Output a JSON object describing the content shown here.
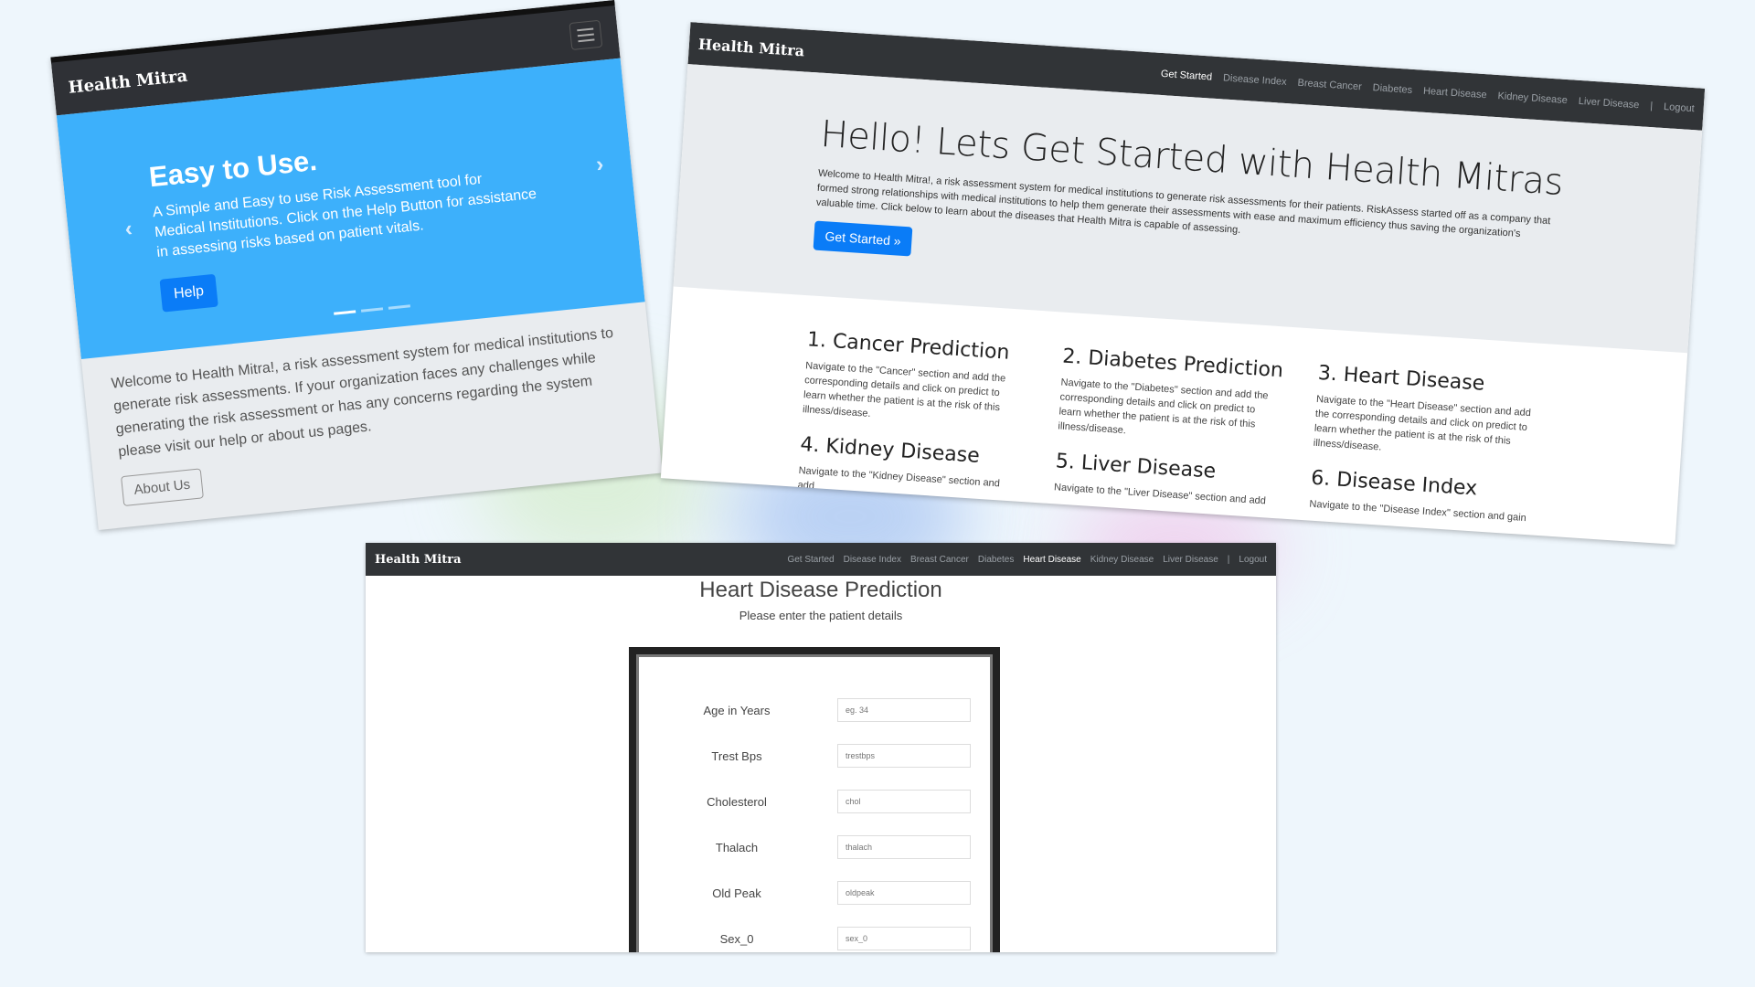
{
  "mobile": {
    "brand": "Health Mitra",
    "carousel": {
      "heading": "Easy to Use.",
      "text": "A Simple and Easy to use Risk Assessment tool for Medical Institutions. Click on the Help Button for assistance in assessing risks based on patient vitals.",
      "button": "Help",
      "prev": "‹",
      "next": "›"
    },
    "body_text": "Welcome to Health Mitra!, a risk assessment system for medical institutions to generate risk assessments. If your organization faces any challenges while generating the risk assessment or has any concerns regarding the system please visit our help or about us pages.",
    "about_button": "About Us"
  },
  "landing": {
    "brand": "Health Mitra",
    "nav": [
      "Get Started",
      "Disease Index",
      "Breast Cancer",
      "Diabetes",
      "Heart Disease",
      "Kidney Disease",
      "Liver Disease"
    ],
    "nav_active": "Get Started",
    "separator": "|",
    "logout": "Logout",
    "heading": "Hello! Lets Get Started with Health Mitras",
    "lead": "Welcome to Health Mitra!, a risk assessment system for medical institutions to generate risk assessments for their patients. RiskAssess started off as a company that formed strong relationships with medical institutions to help them generate their assessments with ease and maximum efficiency thus saving the organization's valuable time. Click below to learn about the diseases that Health Mitra is capable of assessing.",
    "button": "Get Started »",
    "cards": [
      {
        "title": "1. Cancer Prediction",
        "text": "Navigate to the \"Cancer\" section and add the corresponding details and click on predict to learn whether the patient is at the risk of this illness/disease."
      },
      {
        "title": "2. Diabetes Prediction",
        "text": "Navigate to the \"Diabetes\" section and add the corresponding details and click on predict to learn whether the patient is at the risk of this illness/disease."
      },
      {
        "title": "3. Heart Disease",
        "text": "Navigate to the \"Heart Disease\" section and add the corresponding details and click on predict to learn whether the patient is at the risk of this illness/disease."
      },
      {
        "title": "4. Kidney Disease",
        "text": "Navigate to the \"Kidney Disease\" section and add"
      },
      {
        "title": "5. Liver Disease",
        "text": "Navigate to the \"Liver Disease\" section and add"
      },
      {
        "title": "6. Disease Index",
        "text": "Navigate to the \"Disease Index\" section and gain"
      }
    ]
  },
  "heart": {
    "brand": "Health Mitra",
    "nav": [
      "Get Started",
      "Disease Index",
      "Breast Cancer",
      "Diabetes",
      "Heart Disease",
      "Kidney Disease",
      "Liver Disease"
    ],
    "nav_active": "Heart Disease",
    "separator": "|",
    "logout": "Logout",
    "title": "Heart Disease Prediction",
    "subtitle": "Please enter the patient details",
    "fields": [
      {
        "label": "Age in Years",
        "placeholder": "eg. 34"
      },
      {
        "label": "Trest Bps",
        "placeholder": "trestbps"
      },
      {
        "label": "Cholesterol",
        "placeholder": "chol"
      },
      {
        "label": "Thalach",
        "placeholder": "thalach"
      },
      {
        "label": "Old Peak",
        "placeholder": "oldpeak"
      },
      {
        "label": "Sex_0",
        "placeholder": "sex_0"
      }
    ]
  }
}
